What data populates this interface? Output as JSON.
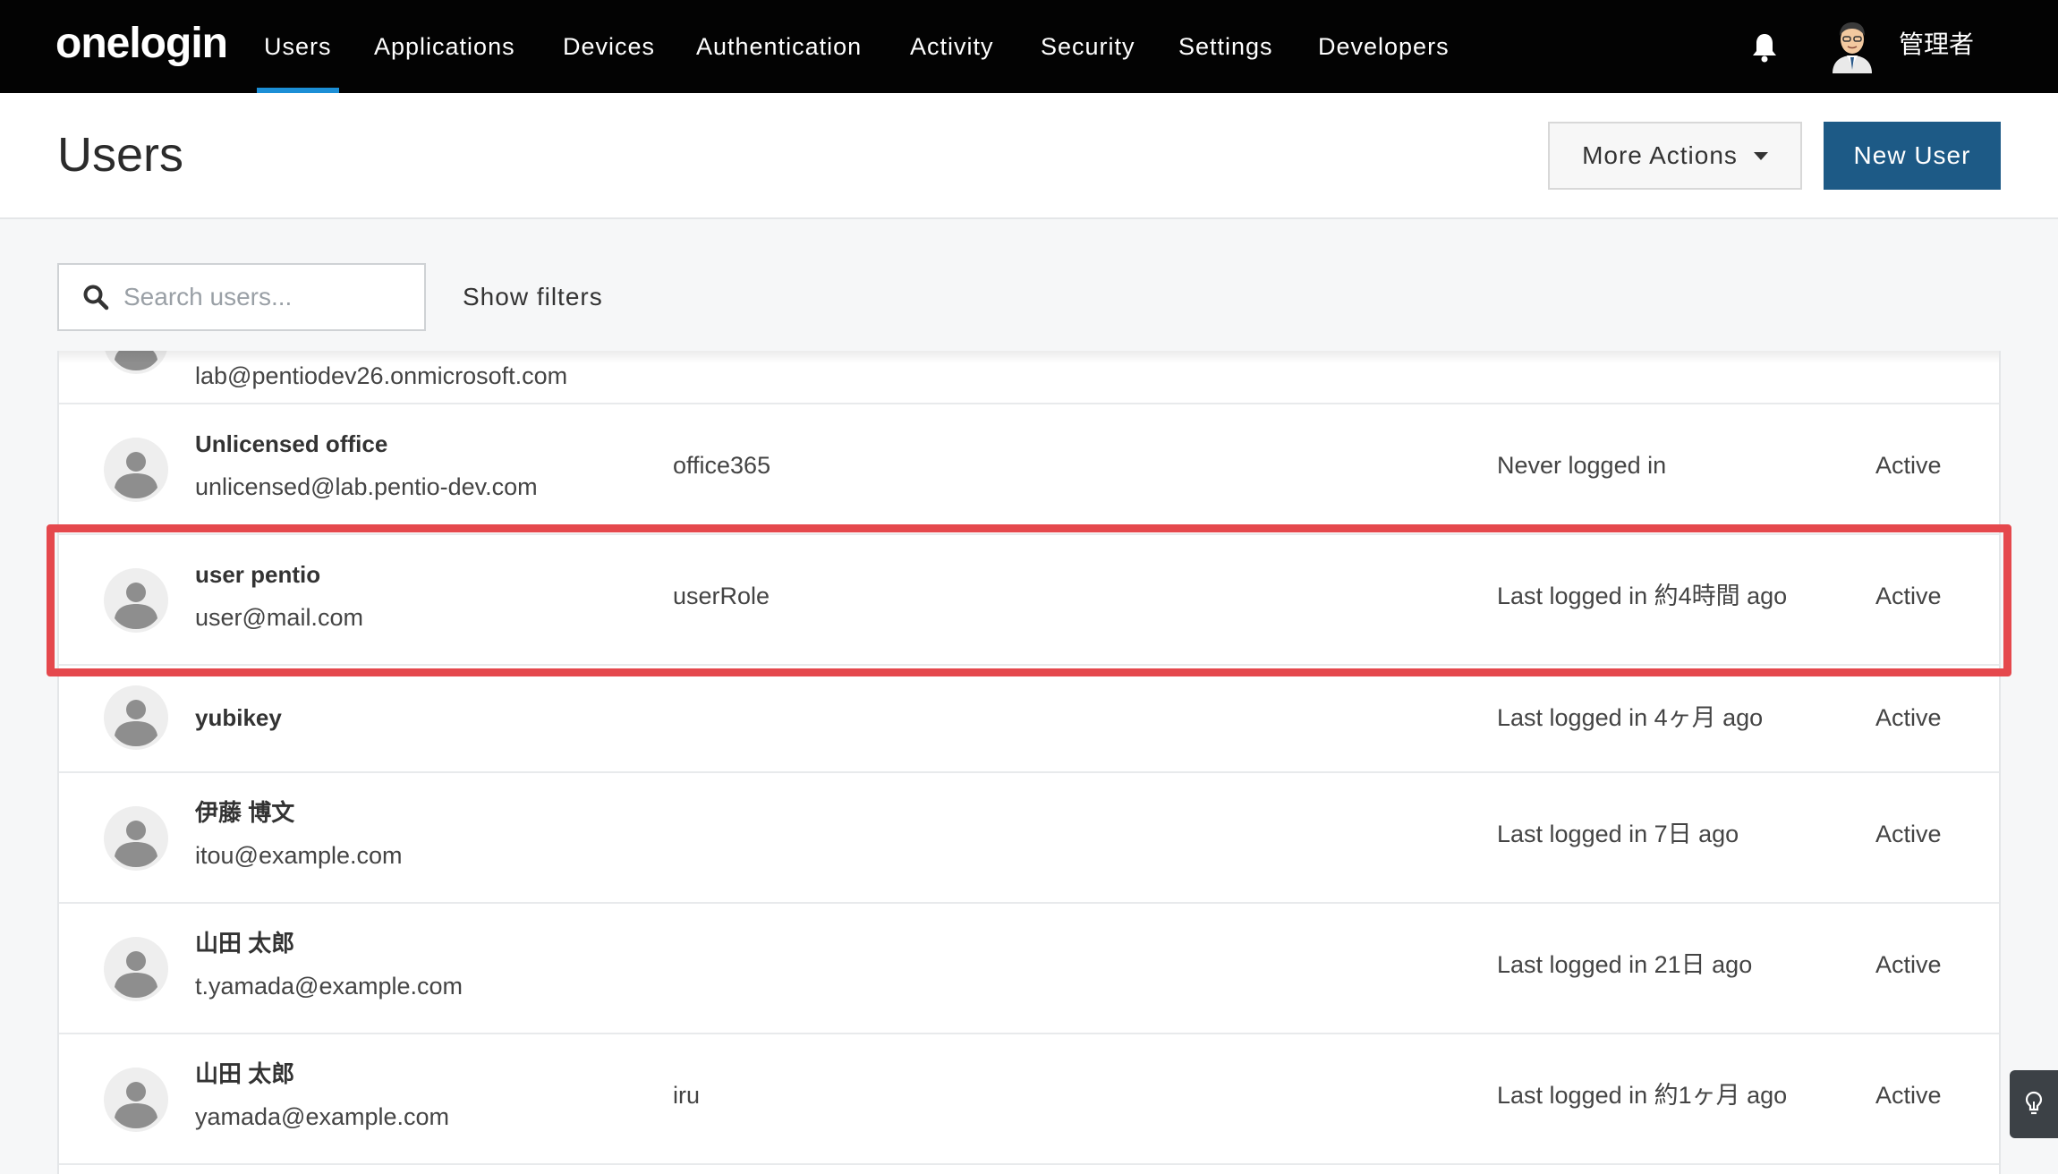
{
  "app": {
    "logo": "onelogin"
  },
  "nav": {
    "items": [
      {
        "label": "Users"
      },
      {
        "label": "Applications"
      },
      {
        "label": "Devices"
      },
      {
        "label": "Authentication"
      },
      {
        "label": "Activity"
      },
      {
        "label": "Security"
      },
      {
        "label": "Settings"
      },
      {
        "label": "Developers"
      }
    ],
    "active": "Users"
  },
  "account": {
    "name": "管理者",
    "notification_icon": "bell-icon"
  },
  "header": {
    "title": "Users",
    "more_actions_label": "More Actions",
    "new_user_label": "New User"
  },
  "search": {
    "placeholder": "Search users...",
    "value": ""
  },
  "filters": {
    "label": "Show filters"
  },
  "users": [
    {
      "name": "",
      "email": "lab@pentiodev26.onmicrosoft.com",
      "role": "",
      "last_login": "",
      "status": ""
    },
    {
      "name": "Unlicensed office",
      "email": "unlicensed@lab.pentio-dev.com",
      "role": "office365",
      "last_login": "Never logged in",
      "status": "Active"
    },
    {
      "name": "user pentio",
      "email": "user@mail.com",
      "role": "userRole",
      "last_login": "Last logged in 約4時間 ago",
      "status": "Active"
    },
    {
      "name": "yubikey",
      "email": "",
      "role": "",
      "last_login": "Last logged in 4ヶ月 ago",
      "status": "Active"
    },
    {
      "name": "伊藤 博文",
      "email": "itou@example.com",
      "role": "",
      "last_login": "Last logged in 7日 ago",
      "status": "Active"
    },
    {
      "name": "山田 太郎",
      "email": "t.yamada@example.com",
      "role": "",
      "last_login": "Last logged in 21日 ago",
      "status": "Active"
    },
    {
      "name": "山田 太郎",
      "email": "yamada@example.com",
      "role": "iru",
      "last_login": "Last logged in 約1ヶ月 ago",
      "status": "Active"
    }
  ],
  "colors": {
    "topbar": "#030303",
    "nav_active_underline": "#1c8fd6",
    "primary_button": "#1d5a86",
    "highlight": "#e5484d"
  }
}
